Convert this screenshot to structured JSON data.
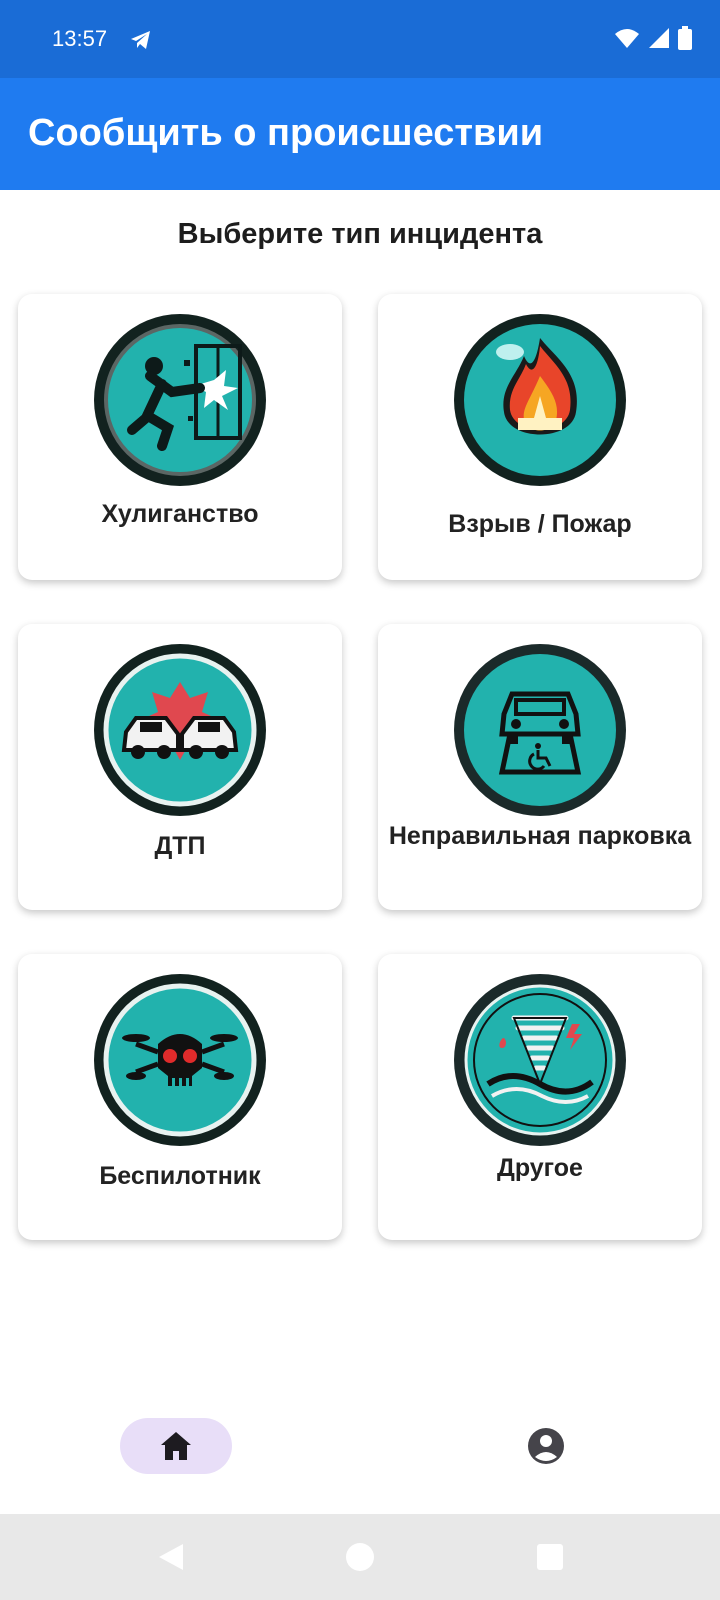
{
  "status_bar": {
    "time": "13:57",
    "icons": [
      "telegram-icon",
      "wifi-icon",
      "signal-icon",
      "battery-icon"
    ]
  },
  "app_bar": {
    "title": "Сообщить о происшествии"
  },
  "page": {
    "subtitle": "Выберите тип инцидента"
  },
  "incident_types": [
    {
      "label": "Хулиганство",
      "icon": "vandalism-icon"
    },
    {
      "label": "Взрыв / Пожар",
      "icon": "fire-icon"
    },
    {
      "label": "ДТП",
      "icon": "car-crash-icon"
    },
    {
      "label": "Неправильная парковка",
      "icon": "wrong-parking-icon"
    },
    {
      "label": "Беспилотник",
      "icon": "drone-icon"
    },
    {
      "label": "Другое",
      "icon": "tornado-icon"
    }
  ],
  "bottom_nav": {
    "items": [
      {
        "icon": "home-icon",
        "selected": true
      },
      {
        "icon": "account-icon",
        "selected": false
      }
    ]
  },
  "colors": {
    "status_bar": "#1a6cd6",
    "app_bar": "#1f7bf0",
    "icon_teal": "#1fb5b3",
    "nav_selected": "#e8def8"
  }
}
